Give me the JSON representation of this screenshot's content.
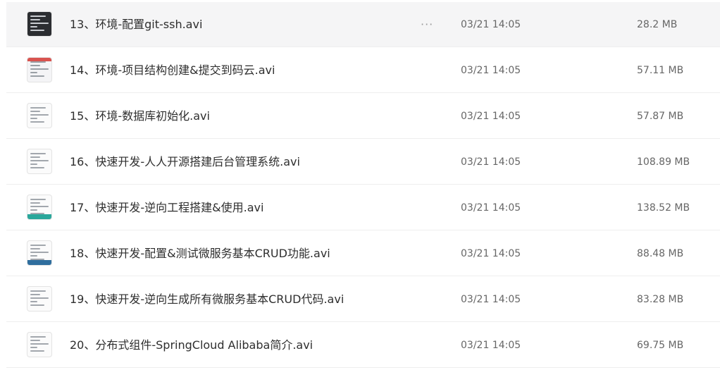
{
  "files": [
    {
      "name": "13、环境-配置git-ssh.avi",
      "date": "03/21 14:05",
      "size": "28.2 MB",
      "thumb": "dark",
      "more": "···"
    },
    {
      "name": "14、环境-项目结构创建&提交到码云.avi",
      "date": "03/21 14:05",
      "size": "57.11 MB",
      "thumb": "browser"
    },
    {
      "name": "15、环境-数据库初始化.avi",
      "date": "03/21 14:05",
      "size": "57.87 MB",
      "thumb": "light"
    },
    {
      "name": "16、快速开发-人人开源搭建后台管理系统.avi",
      "date": "03/21 14:05",
      "size": "108.89 MB",
      "thumb": "light"
    },
    {
      "name": "17、快速开发-逆向工程搭建&使用.avi",
      "date": "03/21 14:05",
      "size": "138.52 MB",
      "thumb": "teal"
    },
    {
      "name": "18、快速开发-配置&测试微服务基本CRUD功能.avi",
      "date": "03/21 14:05",
      "size": "88.48 MB",
      "thumb": "blue"
    },
    {
      "name": "19、快速开发-逆向生成所有微服务基本CRUD代码.avi",
      "date": "03/21 14:05",
      "size": "83.28 MB",
      "thumb": "light"
    },
    {
      "name": "20、分布式组件-SpringCloud Alibaba简介.avi",
      "date": "03/21 14:05",
      "size": "69.75 MB",
      "thumb": "light"
    }
  ]
}
